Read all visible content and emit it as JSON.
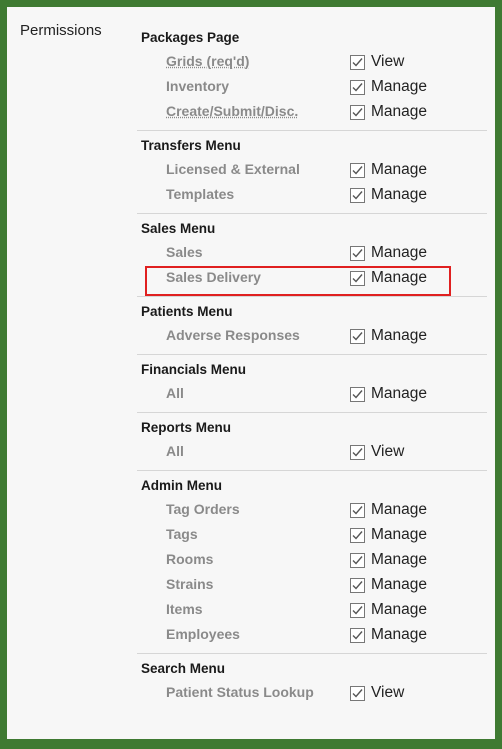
{
  "permissions_label": "Permissions",
  "sections": [
    {
      "title": "Packages Page",
      "rows": [
        {
          "label": "Grids (req'd)",
          "action": "View",
          "underline": true
        },
        {
          "label": "Inventory",
          "action": "Manage"
        },
        {
          "label": "Create/Submit/Disc.",
          "action": "Manage",
          "underline": true
        }
      ]
    },
    {
      "title": "Transfers Menu",
      "rows": [
        {
          "label": "Licensed & External",
          "action": "Manage"
        },
        {
          "label": "Templates",
          "action": "Manage"
        }
      ]
    },
    {
      "title": "Sales Menu",
      "rows": [
        {
          "label": "Sales",
          "action": "Manage"
        },
        {
          "label": "Sales Delivery",
          "action": "Manage"
        }
      ]
    },
    {
      "title": "Patients Menu",
      "rows": [
        {
          "label": "Adverse Responses",
          "action": "Manage"
        }
      ]
    },
    {
      "title": "Financials Menu",
      "rows": [
        {
          "label": "All",
          "action": "Manage"
        }
      ]
    },
    {
      "title": "Reports Menu",
      "rows": [
        {
          "label": "All",
          "action": "View"
        }
      ]
    },
    {
      "title": "Admin Menu",
      "rows": [
        {
          "label": "Tag Orders",
          "action": "Manage"
        },
        {
          "label": "Tags",
          "action": "Manage"
        },
        {
          "label": "Rooms",
          "action": "Manage"
        },
        {
          "label": "Strains",
          "action": "Manage"
        },
        {
          "label": "Items",
          "action": "Manage"
        },
        {
          "label": "Employees",
          "action": "Manage"
        }
      ]
    },
    {
      "title": "Search Menu",
      "rows": [
        {
          "label": "Patient Status Lookup",
          "action": "View"
        }
      ]
    }
  ],
  "colors": {
    "frame": "#3f7a32",
    "highlight": "#e02020"
  }
}
